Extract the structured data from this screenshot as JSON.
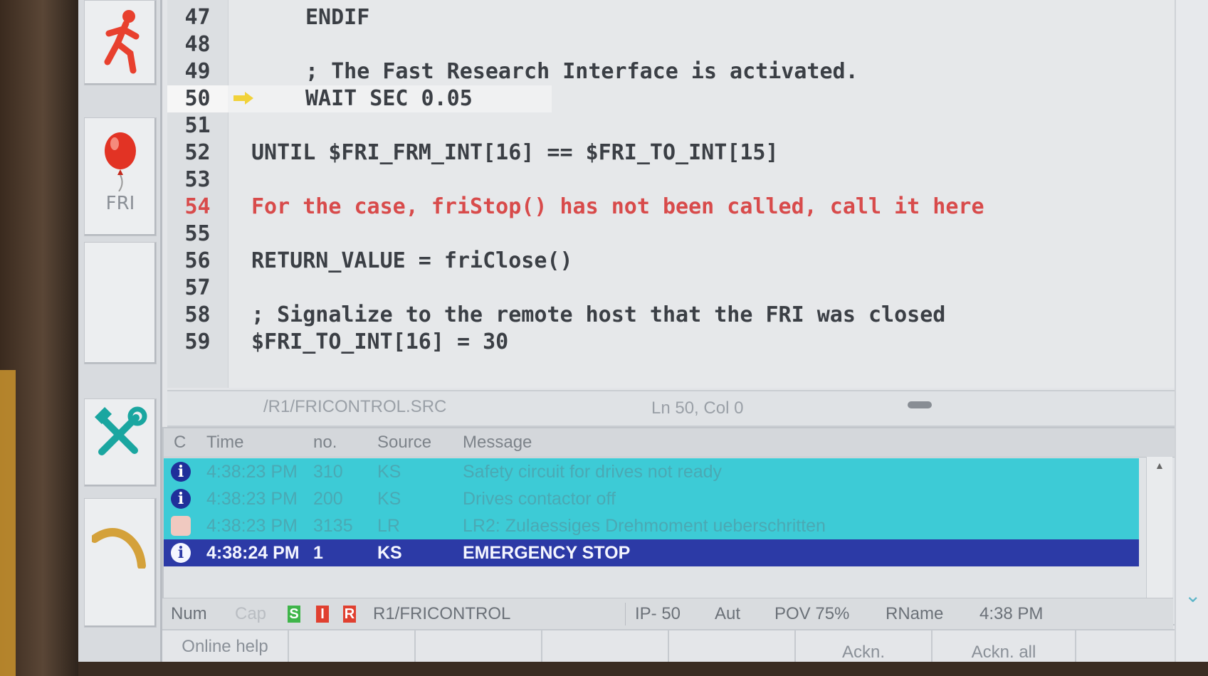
{
  "editor": {
    "lines": [
      {
        "num": "47",
        "code": "ENDIF",
        "indent": 2
      },
      {
        "num": "48",
        "code": "",
        "indent": 0
      },
      {
        "num": "49",
        "code": "; The Fast Research Interface is activated.",
        "indent": 2
      },
      {
        "num": "50",
        "code": "WAIT SEC 0.05",
        "indent": 2,
        "current": true
      },
      {
        "num": "51",
        "code": "",
        "indent": 0
      },
      {
        "num": "52",
        "code": "UNTIL $FRI_FRM_INT[16] == $FRI_TO_INT[15]",
        "indent": 0
      },
      {
        "num": "53",
        "code": "",
        "indent": 0
      },
      {
        "num": "54",
        "code": "For the case, friStop() has not been called, call it here",
        "indent": 0,
        "red": true
      },
      {
        "num": "55",
        "code": "",
        "indent": 0
      },
      {
        "num": "56",
        "code": "RETURN_VALUE = friClose()",
        "indent": 0
      },
      {
        "num": "57",
        "code": "",
        "indent": 0
      },
      {
        "num": "58",
        "code": "; Signalize to the remote host that the FRI was closed",
        "indent": 0
      },
      {
        "num": "59",
        "code": "$FRI_TO_INT[16] = 30",
        "indent": 0
      }
    ],
    "file_path": "/R1/FRICONTROL.SRC",
    "cursor_position": "Ln 50, Col 0"
  },
  "tools": {
    "fri_label": "FRI"
  },
  "messages": {
    "headers": {
      "c": "C",
      "time": "Time",
      "no": "no.",
      "source": "Source",
      "message": "Message"
    },
    "rows": [
      {
        "icon": "i",
        "time": "4:38:23 PM",
        "no": "310",
        "source": "KS",
        "message": "Safety circuit for drives not ready",
        "style": "teal"
      },
      {
        "icon": "i",
        "time": "4:38:23 PM",
        "no": "200",
        "source": "KS",
        "message": "Drives contactor off",
        "style": "teal"
      },
      {
        "icon": "",
        "time": "4:38:23 PM",
        "no": "3135",
        "source": "LR",
        "message": "LR2: Zulaessiges Drehmoment ueberschritten",
        "style": "teal"
      },
      {
        "icon": "i",
        "time": "4:38:24 PM",
        "no": "1",
        "source": "KS",
        "message": "EMERGENCY STOP",
        "style": "selected"
      }
    ]
  },
  "statusbar": {
    "num": "Num",
    "cap": "Cap",
    "led_s": "S",
    "led_i": "I",
    "led_r": "R",
    "program": "R1/FRICONTROL",
    "ip": "IP- 50",
    "mode": "Aut",
    "pov": "POV 75%",
    "rname": "RName",
    "time": "4:38 PM"
  },
  "softkeys": {
    "online_help": "Online help",
    "ackn": "Ackn.",
    "ackn_all": "Ackn. all"
  },
  "colors": {
    "message_teal": "#3dcbd6",
    "message_selected": "#2c3aa6",
    "comment_red": "#d84b4b",
    "led_green": "#3fb54a",
    "led_red": "#e04030"
  }
}
